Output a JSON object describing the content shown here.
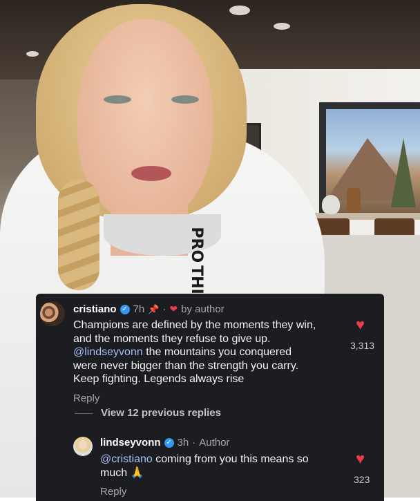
{
  "video": {
    "hoodie_print": [
      "PRO",
      "THIS"
    ]
  },
  "comment": {
    "username": "cristiano",
    "time": "7h",
    "pinned_icon": "pin-icon",
    "author_liked_label": "by author",
    "text_part1": "Champions are defined by the moments they win,\nand the moments they refuse to give up.\n",
    "mention": "@lindseyvonn",
    "text_part2": " the mountains you conquered\nwere never bigger than the strength you carry.\nKeep fighting. Legends always rise",
    "like_count": "3,313",
    "reply_label": "Reply",
    "view_replies_label": "View 12 previous replies"
  },
  "reply_comment": {
    "username": "lindseyvonn",
    "time": "3h",
    "author_badge": "Author",
    "mention": "@cristiano",
    "text": " coming from you this means so\nmuch 🙏",
    "like_count": "323",
    "reply_label": "Reply"
  },
  "colors": {
    "panel_bg": "#1c1d21",
    "heart": "#ed3a48",
    "mention": "#a4bdf6",
    "verified": "#3897f0"
  }
}
